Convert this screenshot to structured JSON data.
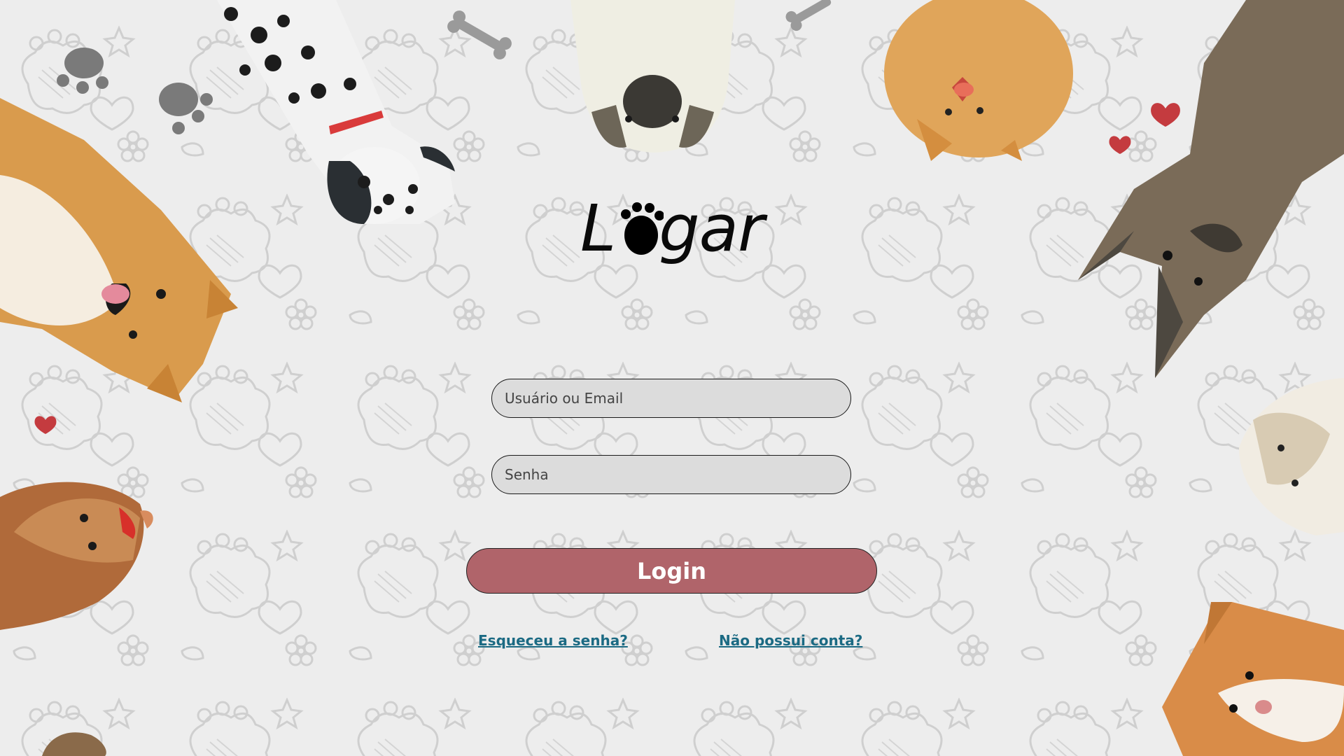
{
  "app": {
    "logo_text_before": "L",
    "logo_text_after": "gar",
    "logo_icon": "paw-icon"
  },
  "form": {
    "username_placeholder": "Usuário ou Email",
    "password_placeholder": "Senha",
    "login_label": "Login",
    "forgot_password_label": "Esqueceu a senha?",
    "signup_label": "Não possui conta?"
  },
  "colors": {
    "background": "#ededed",
    "button": "#b0646a",
    "link": "#1b6a83",
    "input_fill": "#dcdcdc"
  },
  "decorations": [
    "dalmatian-illustration",
    "pug-illustration",
    "pomeranian-illustration",
    "dark-dog-illustration",
    "shiba-illustration",
    "yorkie-illustration",
    "shih-tzu-illustration",
    "corgi-illustration",
    "bone-icon",
    "paw-print-icon",
    "heart-icon"
  ]
}
